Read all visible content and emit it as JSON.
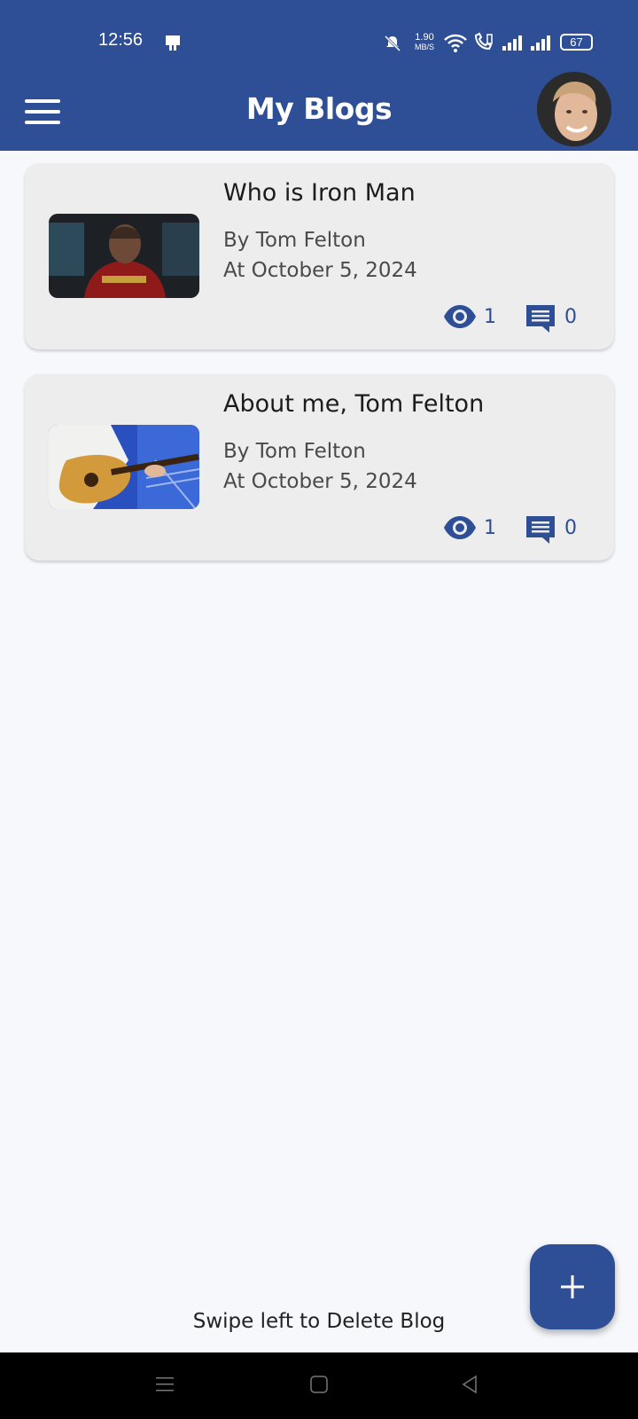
{
  "status_bar": {
    "time": "12:56",
    "speed_value": "1.90",
    "speed_unit": "MB/S",
    "battery": "67"
  },
  "app_bar": {
    "title": "My Blogs"
  },
  "blogs": [
    {
      "title": "Who is Iron Man",
      "author": "By Tom Felton",
      "date": "At October 5, 2024",
      "views": "1",
      "comments": "0"
    },
    {
      "title": "About me, Tom Felton",
      "author": "By Tom Felton",
      "date": "At October 5, 2024",
      "views": "1",
      "comments": "0"
    }
  ],
  "hint": "Swipe left to Delete Blog",
  "colors": {
    "primary": "#2e4e95",
    "background": "#f6f8fc",
    "card": "#ededed"
  }
}
